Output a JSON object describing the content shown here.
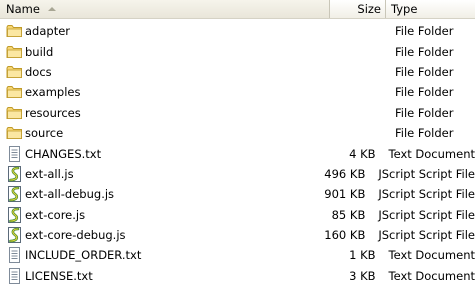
{
  "header": {
    "name": "Name",
    "size": "Size",
    "type": "Type"
  },
  "files": [
    {
      "name": "adapter",
      "size": "",
      "type": "File Folder",
      "icon": "folder-icon"
    },
    {
      "name": "build",
      "size": "",
      "type": "File Folder",
      "icon": "folder-icon"
    },
    {
      "name": "docs",
      "size": "",
      "type": "File Folder",
      "icon": "folder-icon"
    },
    {
      "name": "examples",
      "size": "",
      "type": "File Folder",
      "icon": "folder-icon"
    },
    {
      "name": "resources",
      "size": "",
      "type": "File Folder",
      "icon": "folder-icon"
    },
    {
      "name": "source",
      "size": "",
      "type": "File Folder",
      "icon": "folder-icon"
    },
    {
      "name": "CHANGES.txt",
      "size": "4 KB",
      "type": "Text Document",
      "icon": "text-document-icon"
    },
    {
      "name": "ext-all.js",
      "size": "496 KB",
      "type": "JScript Script File",
      "icon": "jscript-file-icon"
    },
    {
      "name": "ext-all-debug.js",
      "size": "901 KB",
      "type": "JScript Script File",
      "icon": "jscript-file-icon"
    },
    {
      "name": "ext-core.js",
      "size": "85 KB",
      "type": "JScript Script File",
      "icon": "jscript-file-icon"
    },
    {
      "name": "ext-core-debug.js",
      "size": "160 KB",
      "type": "JScript Script File",
      "icon": "jscript-file-icon"
    },
    {
      "name": "INCLUDE_ORDER.txt",
      "size": "1 KB",
      "type": "Text Document",
      "icon": "text-document-icon"
    },
    {
      "name": "LICENSE.txt",
      "size": "3 KB",
      "type": "Text Document",
      "icon": "text-document-icon"
    }
  ]
}
